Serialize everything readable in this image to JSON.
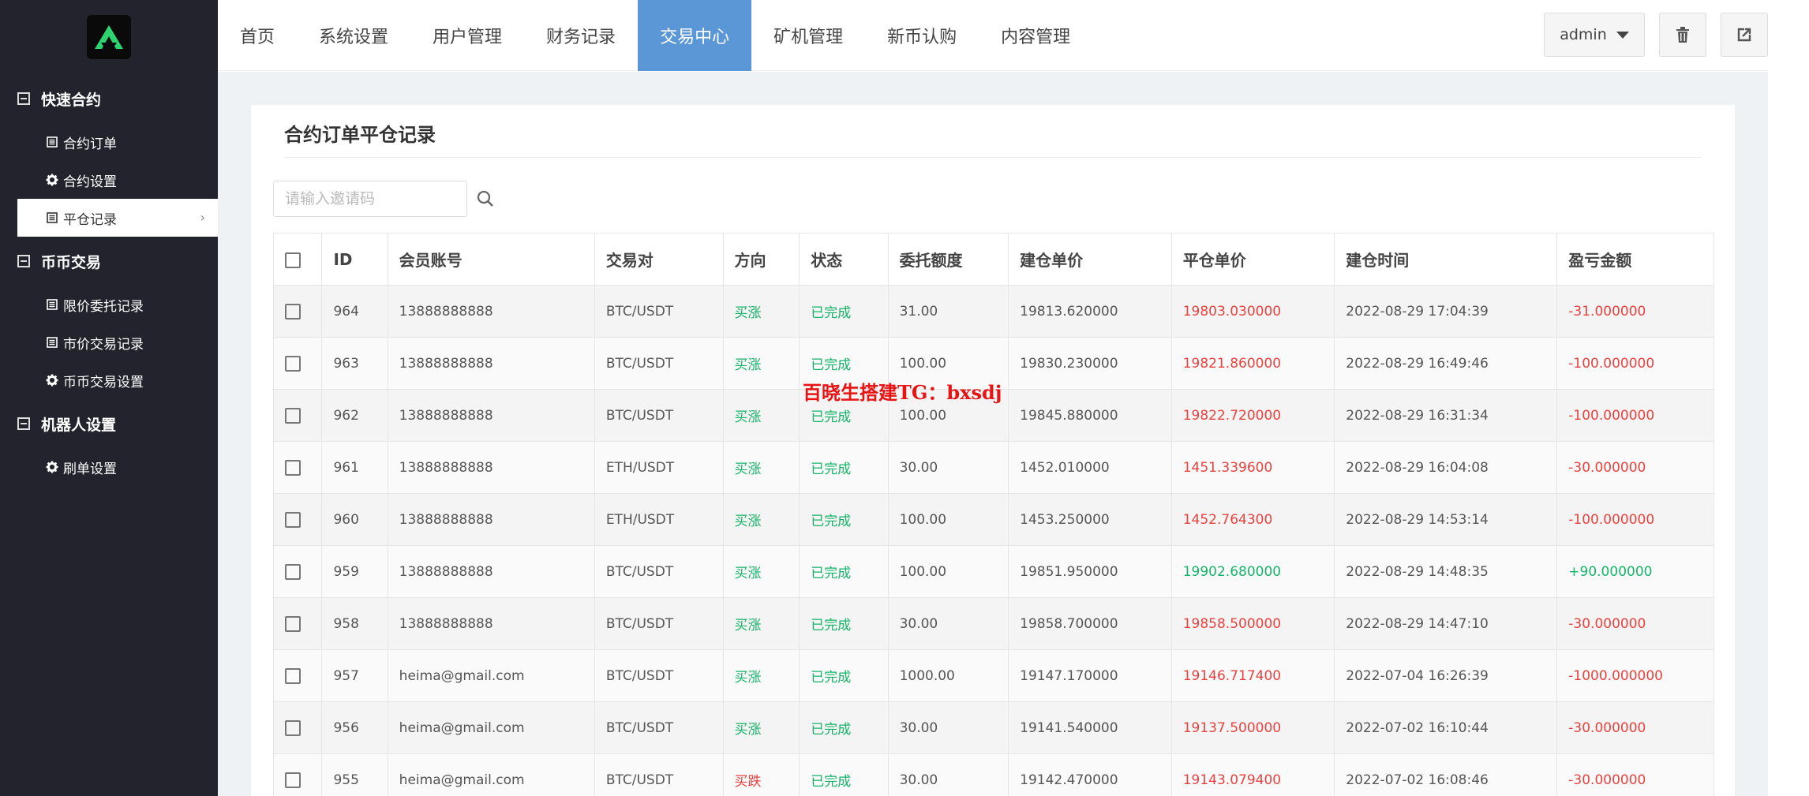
{
  "sidebar": {
    "groups": [
      {
        "title": "快速合约",
        "items": [
          {
            "label": "合约订单",
            "icon": "list-icon"
          },
          {
            "label": "合约设置",
            "icon": "gear-icon"
          },
          {
            "label": "平仓记录",
            "icon": "list-icon",
            "active": true
          }
        ]
      },
      {
        "title": "币币交易",
        "items": [
          {
            "label": "限价委托记录",
            "icon": "list-icon"
          },
          {
            "label": "市价交易记录",
            "icon": "list-icon"
          },
          {
            "label": "币币交易设置",
            "icon": "gear-icon"
          }
        ]
      },
      {
        "title": "机器人设置",
        "items": [
          {
            "label": "刷单设置",
            "icon": "gear-icon"
          }
        ]
      }
    ]
  },
  "nav": {
    "items": [
      "首页",
      "系统设置",
      "用户管理",
      "财务记录",
      "交易中心",
      "矿机管理",
      "新币认购",
      "内容管理"
    ],
    "active": "交易中心"
  },
  "header": {
    "user": "admin"
  },
  "panel": {
    "title": "合约订单平仓记录",
    "search_placeholder": "请输入邀请码"
  },
  "table": {
    "headers": [
      "ID",
      "会员账号",
      "交易对",
      "方向",
      "状态",
      "委托额度",
      "建仓单价",
      "平仓单价",
      "建仓时间",
      "盈亏金额"
    ],
    "rows": [
      {
        "id": "964",
        "account": "13888888888",
        "pair": "BTC/USDT",
        "direction": "买涨",
        "status": "已完成",
        "amount": "31.00",
        "open": "19813.620000",
        "close": "19803.030000",
        "time": "2022-08-29 17:04:39",
        "pnl": "-31.000000"
      },
      {
        "id": "963",
        "account": "13888888888",
        "pair": "BTC/USDT",
        "direction": "买涨",
        "status": "已完成",
        "amount": "100.00",
        "open": "19830.230000",
        "close": "19821.860000",
        "time": "2022-08-29 16:49:46",
        "pnl": "-100.000000"
      },
      {
        "id": "962",
        "account": "13888888888",
        "pair": "BTC/USDT",
        "direction": "买涨",
        "status": "已完成",
        "amount": "100.00",
        "open": "19845.880000",
        "close": "19822.720000",
        "time": "2022-08-29 16:31:34",
        "pnl": "-100.000000"
      },
      {
        "id": "961",
        "account": "13888888888",
        "pair": "ETH/USDT",
        "direction": "买涨",
        "status": "已完成",
        "amount": "30.00",
        "open": "1452.010000",
        "close": "1451.339600",
        "time": "2022-08-29 16:04:08",
        "pnl": "-30.000000"
      },
      {
        "id": "960",
        "account": "13888888888",
        "pair": "ETH/USDT",
        "direction": "买涨",
        "status": "已完成",
        "amount": "100.00",
        "open": "1453.250000",
        "close": "1452.764300",
        "time": "2022-08-29 14:53:14",
        "pnl": "-100.000000"
      },
      {
        "id": "959",
        "account": "13888888888",
        "pair": "BTC/USDT",
        "direction": "买涨",
        "status": "已完成",
        "amount": "100.00",
        "open": "19851.950000",
        "close": "19902.680000",
        "time": "2022-08-29 14:48:35",
        "pnl": "+90.000000"
      },
      {
        "id": "958",
        "account": "13888888888",
        "pair": "BTC/USDT",
        "direction": "买涨",
        "status": "已完成",
        "amount": "30.00",
        "open": "19858.700000",
        "close": "19858.500000",
        "time": "2022-08-29 14:47:10",
        "pnl": "-30.000000"
      },
      {
        "id": "957",
        "account": "heima@gmail.com",
        "pair": "BTC/USDT",
        "direction": "买涨",
        "status": "已完成",
        "amount": "1000.00",
        "open": "19147.170000",
        "close": "19146.717400",
        "time": "2022-07-04 16:26:39",
        "pnl": "-1000.000000"
      },
      {
        "id": "956",
        "account": "heima@gmail.com",
        "pair": "BTC/USDT",
        "direction": "买涨",
        "status": "已完成",
        "amount": "30.00",
        "open": "19141.540000",
        "close": "19137.500000",
        "time": "2022-07-02 16:10:44",
        "pnl": "-30.000000"
      },
      {
        "id": "955",
        "account": "heima@gmail.com",
        "pair": "BTC/USDT",
        "direction": "买跌",
        "status": "已完成",
        "amount": "30.00",
        "open": "19142.470000",
        "close": "19143.079400",
        "time": "2022-07-02 16:08:46",
        "pnl": "-30.000000"
      }
    ]
  },
  "watermark": "百晓生搭建TG：bxsdj",
  "colors": {
    "accent": "#5b97d6",
    "sidebar": "#23232e",
    "profit": "#16b469",
    "loss": "#e8423f"
  }
}
